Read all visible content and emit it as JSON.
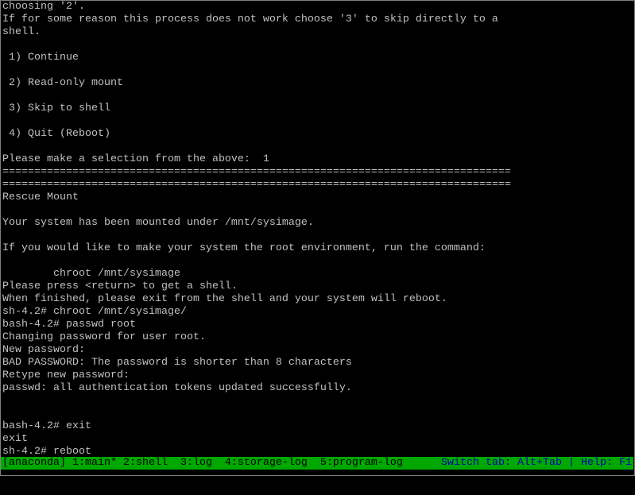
{
  "terminal": {
    "lines": [
      "choosing '2'.",
      "If for some reason this process does not work choose '3' to skip directly to a",
      "shell.",
      "",
      " 1) Continue",
      "",
      " 2) Read-only mount",
      "",
      " 3) Skip to shell",
      "",
      " 4) Quit (Reboot)",
      "",
      "Please make a selection from the above:  1",
      "================================================================================",
      "================================================================================",
      "Rescue Mount",
      "",
      "Your system has been mounted under /mnt/sysimage.",
      "",
      "If you would like to make your system the root environment, run the command:",
      "",
      "        chroot /mnt/sysimage",
      "Please press <return> to get a shell.",
      "When finished, please exit from the shell and your system will reboot.",
      "sh-4.2# chroot /mnt/sysimage/",
      "bash-4.2# passwd root",
      "Changing password for user root.",
      "New password:",
      "BAD PASSWORD: The password is shorter than 8 characters",
      "Retype new password:",
      "passwd: all authentication tokens updated successfully.",
      "",
      "",
      "bash-4.2# exit",
      "exit",
      "sh-4.2# reboot"
    ]
  },
  "statusbar": {
    "tabs": "[anaconda] 1:main* 2:shell  3:log  4:storage-log  5:program-log",
    "hint": "Switch tab: Alt+Tab | Help: F1",
    "bg_color": "#00a800",
    "hint_color": "#0000b0"
  }
}
